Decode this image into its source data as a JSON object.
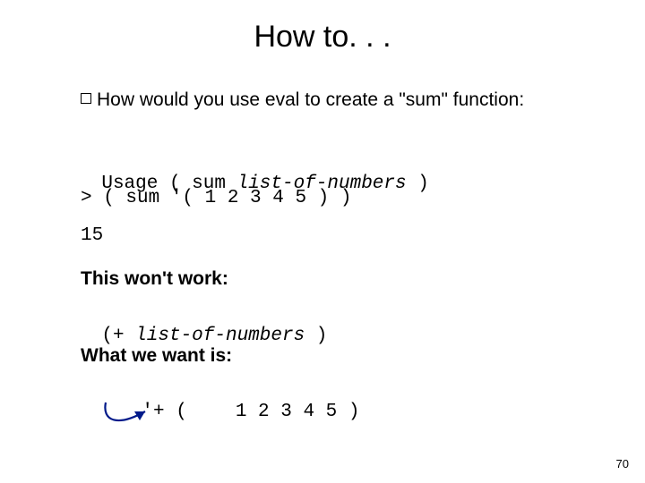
{
  "title": "How to. . .",
  "bullet": "How would you use eval to create a \"sum\" function:",
  "usage": {
    "prefix": "Usage ( sum ",
    "arg": "list-of-numbers",
    "suffix": " )"
  },
  "call": "> ( sum '( 1 2 3 4 5 ) )",
  "result": "15",
  "wont_work_label": "This won't work:",
  "plus_expr": {
    "prefix": "(+ ",
    "arg": "list-of-numbers",
    "suffix": " )"
  },
  "want_label": "What we want is:",
  "quote_expr": {
    "left": "'+ (",
    "right": "1 2 3 4 5 )"
  },
  "arrow_color": "#001a8a",
  "page_number": "70"
}
